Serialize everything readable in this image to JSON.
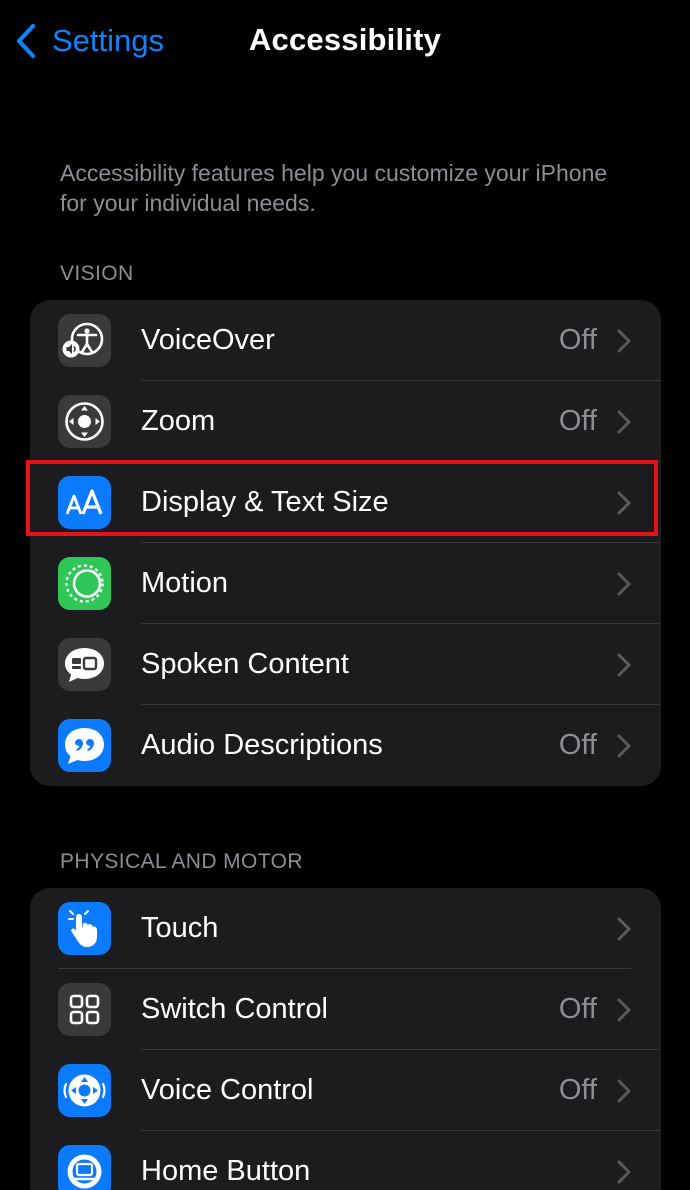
{
  "nav": {
    "back_label": "Settings",
    "title": "Accessibility"
  },
  "intro": "Accessibility features help you customize your iPhone for your individual needs.",
  "sections": [
    {
      "header": "VISION",
      "items": [
        {
          "label": "VoiceOver",
          "value": "Off",
          "icon": "voiceover-icon"
        },
        {
          "label": "Zoom",
          "value": "Off",
          "icon": "zoom-icon"
        },
        {
          "label": "Display & Text Size",
          "value": "",
          "icon": "display-text-size-icon",
          "highlighted": true
        },
        {
          "label": "Motion",
          "value": "",
          "icon": "motion-icon"
        },
        {
          "label": "Spoken Content",
          "value": "",
          "icon": "spoken-content-icon"
        },
        {
          "label": "Audio Descriptions",
          "value": "Off",
          "icon": "audio-descriptions-icon"
        }
      ]
    },
    {
      "header": "PHYSICAL AND MOTOR",
      "items": [
        {
          "label": "Touch",
          "value": "",
          "icon": "touch-icon"
        },
        {
          "label": "Switch Control",
          "value": "Off",
          "icon": "switch-control-icon"
        },
        {
          "label": "Voice Control",
          "value": "Off",
          "icon": "voice-control-icon"
        },
        {
          "label": "Home Button",
          "value": "",
          "icon": "home-button-icon"
        }
      ]
    }
  ],
  "colors": {
    "accent": "#0a84ff",
    "background": "#000000",
    "cell": "#1c1c1e",
    "secondary_text": "#8d8d93",
    "highlight": "#e5141b",
    "icon_gray": "#3a3a3c",
    "icon_blue": "#0a7aff",
    "icon_green": "#30c759"
  }
}
